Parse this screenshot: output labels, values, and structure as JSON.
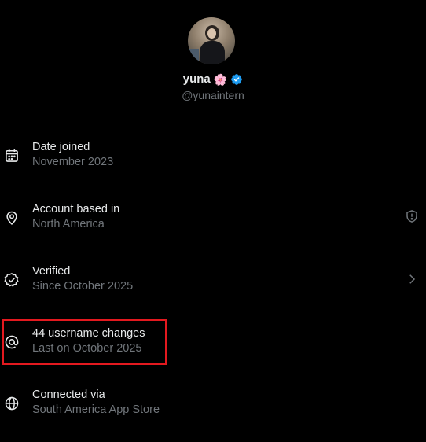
{
  "profile": {
    "display_name": "yuna",
    "name_emoji": "🌸",
    "handle": "@yunaintern",
    "verified": true
  },
  "rows": [
    {
      "icon": "calendar-icon",
      "title": "Date joined",
      "subtitle": "November 2023"
    },
    {
      "icon": "location-pin-icon",
      "title": "Account based in",
      "subtitle": "North America",
      "right_icon": "shield-icon"
    },
    {
      "icon": "verified-badge-icon",
      "title": "Verified",
      "subtitle": "Since October 2025",
      "right_icon": "chevron-right-icon"
    },
    {
      "icon": "at-sign-icon",
      "title": "44 username changes",
      "subtitle": "Last on October 2025",
      "highlighted": true
    },
    {
      "icon": "globe-icon",
      "title": "Connected via",
      "subtitle": "South America App Store"
    }
  ],
  "colors": {
    "background": "#000000",
    "primary_text": "#e7e9ea",
    "secondary_text": "#71767b",
    "verified_blue": "#1d9bf0",
    "highlight_red": "#e3191f"
  }
}
